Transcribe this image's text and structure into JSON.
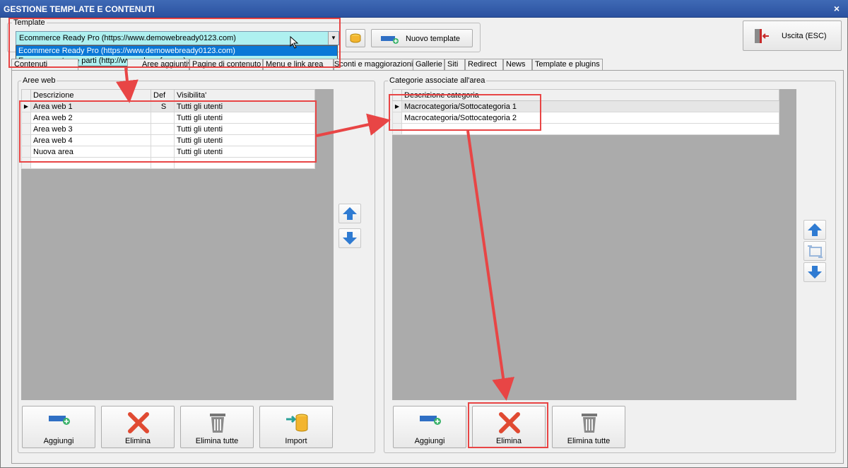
{
  "window": {
    "title": "GESTIONE TEMPLATE E CONTENUTI",
    "close_glyph": "×"
  },
  "template": {
    "legend": "Template",
    "selected": "Ecommerce Ready Pro (https://www.demowebready0123.com)",
    "options": [
      "Ecommerce Ready Pro (https://www.demowebready0123.com)",
      "Ecommerce terze parti (http://www.abcsefg.com)"
    ],
    "new_template_label": "Nuovo template",
    "exit_label": "Uscita (ESC)"
  },
  "tabs": [
    "Contenuti",
    "Aree aggiuntive",
    "Pagine di contenuto",
    "Menu e link area",
    "Sconti e maggiorazioni",
    "Gallerie",
    "Siti",
    "Redirect",
    "News",
    "Template e plugins"
  ],
  "areas": {
    "legend": "Aree web",
    "columns": [
      "Descrizione",
      "Def",
      "Visibilita'"
    ],
    "rows": [
      {
        "desc": "Area web 1",
        "def": "S",
        "vis": "Tutti gli utenti"
      },
      {
        "desc": "Area web 2",
        "def": "",
        "vis": "Tutti gli utenti"
      },
      {
        "desc": "Area web 3",
        "def": "",
        "vis": "Tutti gli utenti"
      },
      {
        "desc": "Area web 4",
        "def": "",
        "vis": "Tutti gli utenti"
      },
      {
        "desc": "Nuova area",
        "def": "",
        "vis": "Tutti gli utenti"
      }
    ],
    "buttons": [
      "Aggiungi",
      "Elimina",
      "Elimina tutte",
      "Import"
    ]
  },
  "categories": {
    "legend": "Categorie associate all'area",
    "column": "Descrizione categoria",
    "rows": [
      "Macrocategoria/Sottocategoria 1",
      "Macrocategoria/Sottocategoria 2"
    ],
    "buttons": [
      "Aggiungi",
      "Elimina",
      "Elimina tutte"
    ]
  },
  "colors": {
    "accent_red": "#e84545",
    "dropdown_bg": "#aef0f0",
    "selection_blue": "#0a78d7",
    "grid_bg": "#ababab",
    "arrow_blue": "#2f7bd2"
  },
  "icons": [
    "close-icon",
    "chevron-down-icon",
    "cursor-icon",
    "folder-icon",
    "add-template-icon",
    "exit-door-icon",
    "arrow-up-icon",
    "arrow-down-icon",
    "sort-icon",
    "add-icon",
    "delete-x-icon",
    "trash-icon",
    "import-icon"
  ]
}
